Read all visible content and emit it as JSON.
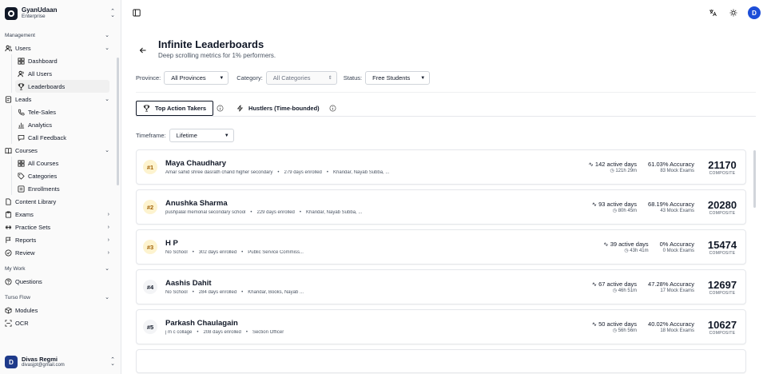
{
  "brand": {
    "name": "GyanUdaan",
    "plan": "Enterprise"
  },
  "sidebar": {
    "management_label": "Management",
    "users_label": "Users",
    "users_sub": [
      "Dashboard",
      "All Users",
      "Leaderboards"
    ],
    "leads_label": "Leads",
    "leads_sub": [
      "Tele-Sales",
      "Analytics",
      "Call Feedback"
    ],
    "courses_label": "Courses",
    "courses_sub": [
      "All Courses",
      "Categories",
      "Enrollments"
    ],
    "content_library": "Content Library",
    "exams": "Exams",
    "practice_sets": "Practice Sets",
    "reports": "Reports",
    "review": "Review",
    "mywork_label": "My Work",
    "questions": "Questions",
    "turso_label": "Turso Flow",
    "modules": "Modules",
    "ocr": "OCR"
  },
  "user": {
    "name": "Divas Regmi",
    "email": "divasjpt@gmail.com",
    "initial": "D"
  },
  "topbar": {
    "avatar_initial": "D"
  },
  "page": {
    "title": "Infinite Leaderboards",
    "subtitle": "Deep scrolling metrics for 1% performers."
  },
  "filters": {
    "province_label": "Province:",
    "province_value": "All Provinces",
    "category_label": "Category:",
    "category_value": "All Categories",
    "status_label": "Status:",
    "status_value": "Free Students"
  },
  "tabs": {
    "top_action": "Top Action Takers",
    "hustlers": "Hustlers (Time-bounded)"
  },
  "timeframe": {
    "label": "Timeframe:",
    "value": "Lifetime"
  },
  "composite_label": "COMPOSITE",
  "leaders": [
    {
      "rank": "#1",
      "name": "Maya Chaudhary",
      "school": "Amar sahid shree dasrath chand higher secondary",
      "enrolled": "279 days enrolled",
      "location": "Kharidar, Nayab Subba, ...",
      "active_days": "142 active days",
      "time": "121h 29m",
      "accuracy": "61.03% Accuracy",
      "mocks": "83 Mock Exams",
      "score": "21170"
    },
    {
      "rank": "#2",
      "name": "Anushka Sharma",
      "school": "pushpalal memorial secondary school",
      "enrolled": "229 days enrolled",
      "location": "Kharidar, Nayab Subba, ...",
      "active_days": "93 active days",
      "time": "80h 45m",
      "accuracy": "68.19% Accuracy",
      "mocks": "43 Mock Exams",
      "score": "20280"
    },
    {
      "rank": "#3",
      "name": "H P",
      "school": "No School",
      "enrolled": "302 days enrolled",
      "location": "Public Service Commiss...",
      "active_days": "39 active days",
      "time": "43h 41m",
      "accuracy": "0% Accuracy",
      "mocks": "0 Mock Exams",
      "score": "15474"
    },
    {
      "rank": "#4",
      "name": "Aashis Dahit",
      "school": "No School",
      "enrolled": "284 days enrolled",
      "location": "Kharidar, Books, Nayab ...",
      "active_days": "67 active days",
      "time": "46h 51m",
      "accuracy": "47.28% Accuracy",
      "mocks": "17 Mock Exams",
      "score": "12697"
    },
    {
      "rank": "#5",
      "name": "Parkash Chaulagain",
      "school": "j m c collage",
      "enrolled": "208 days enrolled",
      "location": "Section Officer",
      "active_days": "50 active days",
      "time": "56h 56m",
      "accuracy": "40.02% Accuracy",
      "mocks": "18 Mock Exams",
      "score": "10627"
    }
  ]
}
